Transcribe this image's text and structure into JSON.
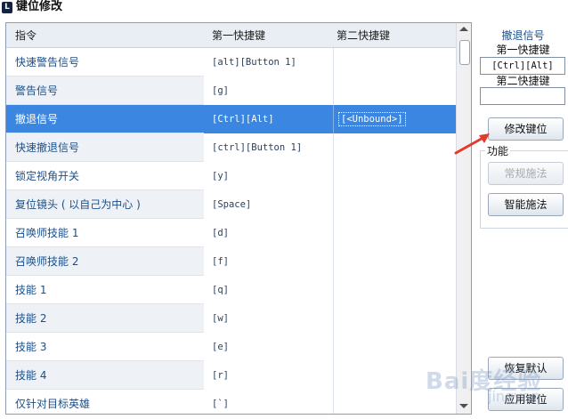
{
  "window": {
    "title": "键位修改",
    "icon": "app-icon"
  },
  "table": {
    "headers": [
      "指令",
      "第一快捷键",
      "第二快捷键"
    ],
    "rows": [
      {
        "command": "快速警告信号",
        "key1": "[alt][Button 1]",
        "key2": ""
      },
      {
        "command": "警告信号",
        "key1": "[g]",
        "key2": ""
      },
      {
        "command": "撤退信号",
        "key1": "[Ctrl][Alt]",
        "key2": "[<Unbound>]",
        "selected": true
      },
      {
        "command": "快速撤退信号",
        "key1": "[ctrl][Button 1]",
        "key2": ""
      },
      {
        "command": "锁定视角开关",
        "key1": "[y]",
        "key2": ""
      },
      {
        "command": "复位镜头 ( 以自己为中心 )",
        "key1": "[Space]",
        "key2": ""
      },
      {
        "command": "召唤师技能 1",
        "key1": "[d]",
        "key2": ""
      },
      {
        "command": "召唤师技能 2",
        "key1": "[f]",
        "key2": ""
      },
      {
        "command": "技能 1",
        "key1": "[q]",
        "key2": ""
      },
      {
        "command": "技能 2",
        "key1": "[w]",
        "key2": ""
      },
      {
        "command": "技能 3",
        "key1": "[e]",
        "key2": ""
      },
      {
        "command": "技能 4",
        "key1": "[r]",
        "key2": ""
      },
      {
        "command": "仅针对目标英雄",
        "key1": "[`]",
        "key2": ""
      }
    ]
  },
  "panel": {
    "selected_command": "撤退信号",
    "primary_label": "第一快捷键",
    "primary_value": "[Ctrl][Alt]",
    "secondary_label": "第二快捷键",
    "secondary_value": "",
    "modify_button": "修改键位",
    "function_group_label": "功能",
    "normal_cast_button": "常规施法",
    "smart_cast_button": "智能施法",
    "restore_default_button": "恢复默认",
    "apply_button": "应用键位"
  },
  "watermark": {
    "text": "Bai度经验",
    "sub": "jingyan"
  },
  "colors": {
    "selected_row": "#3a86e0",
    "annotation_arrow": "#e23b2e"
  }
}
